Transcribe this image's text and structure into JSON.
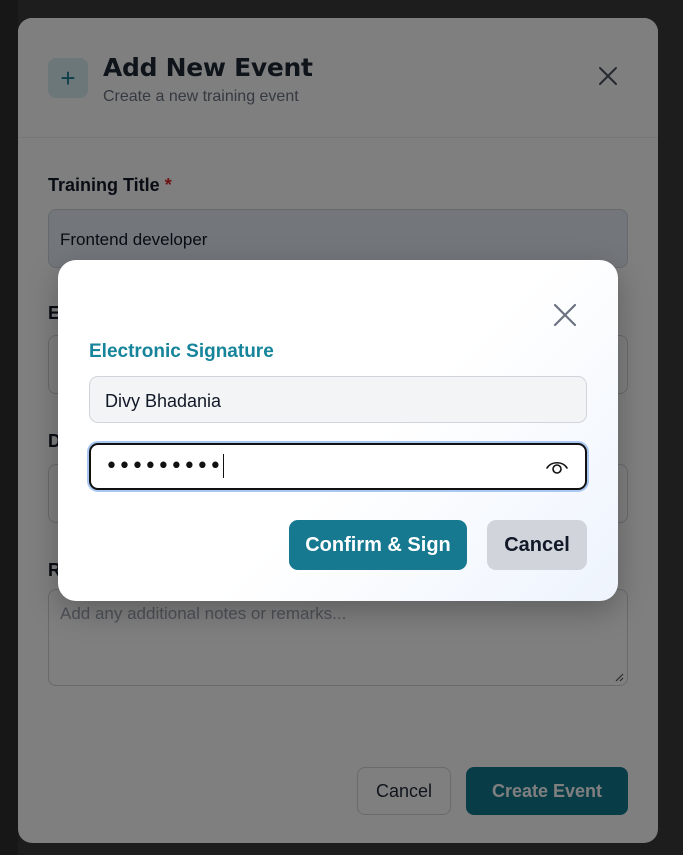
{
  "event_modal": {
    "title": "Add New Event",
    "subtitle": "Create a new training event",
    "plus_icon": "+",
    "fields": {
      "training_title": {
        "label": "Training Title",
        "required_mark": "*",
        "value": "Frontend developer"
      },
      "field2_label_visible": "E",
      "field3_label_visible": "D",
      "remarks": {
        "label_visible": "R",
        "placeholder": "Add any additional notes or remarks..."
      }
    },
    "footer": {
      "cancel_label": "Cancel",
      "create_label": "Create Event"
    }
  },
  "signature_dialog": {
    "title": "Electronic Signature",
    "name_value": "Divy Bhadania",
    "password_masked": "•••••••••",
    "confirm_label": "Confirm & Sign",
    "cancel_label": "Cancel"
  },
  "colors": {
    "accent": "#16798f",
    "title_accent": "#16849a",
    "required": "#dc2626"
  }
}
